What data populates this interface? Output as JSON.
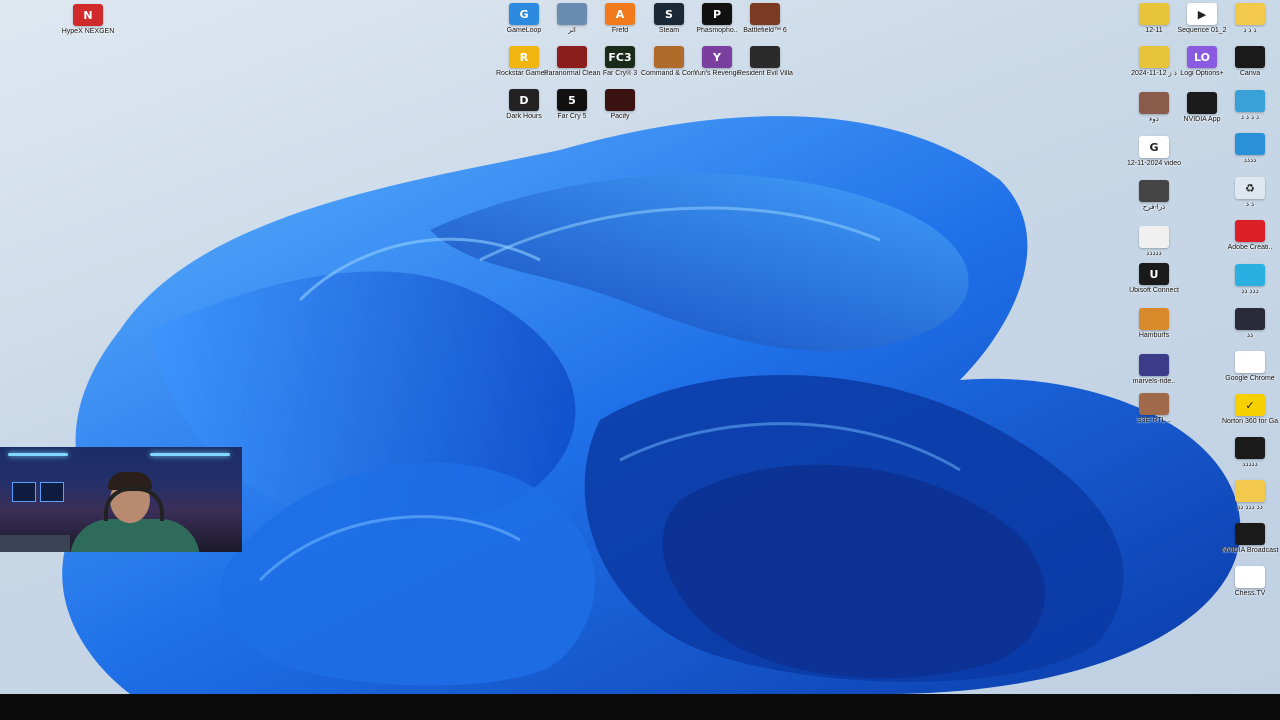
{
  "desktop": {
    "top_left": [
      {
        "label": "HypeX NEXGEN",
        "icon": "hypex-icon",
        "color": "#d12a2a",
        "glyph": "N"
      }
    ],
    "center_icons": [
      {
        "label": "GameLoop",
        "icon": "gameloop-icon",
        "color": "#2c8ae0",
        "glyph": "G"
      },
      {
        "label": "اثر",
        "icon": "game-thumbnail-icon",
        "color": "#6a8cb0",
        "glyph": ""
      },
      {
        "label": "Frefd",
        "icon": "orange-a-icon",
        "color": "#f07a1c",
        "glyph": "A"
      },
      {
        "label": "Steam",
        "icon": "steam-icon",
        "color": "#1b2838",
        "glyph": "S"
      },
      {
        "label": "Phasmopho..",
        "icon": "phasmophobia-icon",
        "color": "#111111",
        "glyph": "P"
      },
      {
        "label": "Battlefield™ 6",
        "icon": "battlefield-icon",
        "color": "#7a3b22",
        "glyph": ""
      },
      {
        "label": "Rockstar Games ..",
        "icon": "rockstar-icon",
        "color": "#f1b50f",
        "glyph": "R"
      },
      {
        "label": "Paranormal Cleanup",
        "icon": "paranormal-cleanup-icon",
        "color": "#8c1d1d",
        "glyph": ""
      },
      {
        "label": "Far Cry® 3",
        "icon": "farcry3-icon",
        "color": "#1a2b1a",
        "glyph": "FC3"
      },
      {
        "label": "Command & Conquer Re..",
        "icon": "command-conquer-icon",
        "color": "#b06a2a",
        "glyph": ""
      },
      {
        "label": "Yuri's Revenge",
        "icon": "yuris-revenge-icon",
        "color": "#7b3fa0",
        "glyph": "Y"
      },
      {
        "label": "Resident Evil Village",
        "icon": "resident-evil-icon",
        "color": "#2b2b2b",
        "glyph": ""
      },
      {
        "label": "Dark Hours",
        "icon": "dark-hours-icon",
        "color": "#222222",
        "glyph": "D"
      },
      {
        "label": "Far Cry 5",
        "icon": "farcry5-icon",
        "color": "#111111",
        "glyph": "5"
      },
      {
        "label": "Pacify",
        "icon": "pacify-icon",
        "color": "#3a1212",
        "glyph": ""
      }
    ],
    "right_col_a": [
      {
        "label": "12-11",
        "icon": "folder-stripe-icon",
        "color": "#e8c43a",
        "glyph": ""
      },
      {
        "label": "ذ ز 12-11-2024",
        "icon": "folder-stripe-icon",
        "color": "#e8c43a",
        "glyph": ""
      },
      {
        "label": "ذوء",
        "icon": "image-thumbnail-icon",
        "color": "#8a5a4a",
        "glyph": ""
      },
      {
        "label": "12-11-2024 video",
        "icon": "chrome-doc-icon",
        "color": "#ffffff",
        "glyph": "G"
      },
      {
        "label": "ذرا-فرح",
        "icon": "video-file-icon",
        "color": "#444444",
        "glyph": ""
      },
      {
        "label": "ذذذذذ",
        "icon": "blank-doc-icon",
        "color": "#f0f0f0",
        "glyph": ""
      },
      {
        "label": "Ubisoft Connect",
        "icon": "ubisoft-icon",
        "color": "#1a1a1a",
        "glyph": "U"
      },
      {
        "label": "Hamburfs",
        "icon": "hamburger-icon",
        "color": "#d88a2a",
        "glyph": ""
      },
      {
        "label": "marvels-ride..",
        "icon": "marvel-thumbnail-icon",
        "color": "#3b3b8a",
        "glyph": ""
      },
      {
        "label": "S3E-RTL ..",
        "icon": "portrait-thumbnail-icon",
        "color": "#a06a4a",
        "glyph": ""
      }
    ],
    "right_col_b": [
      {
        "label": "Sequence 01_2",
        "icon": "video-play-icon",
        "color": "#ffffff",
        "glyph": "▶"
      },
      {
        "label": "Logi Options+",
        "icon": "logi-options-icon",
        "color": "#8a5ae0",
        "glyph": "LO"
      },
      {
        "label": "NVIDIA App",
        "icon": "nvidia-icon",
        "color": "#1a1a1a",
        "glyph": ""
      }
    ],
    "right_col_c": [
      {
        "label": "ذ ذ ذ",
        "icon": "folder-icon",
        "color": "#f2c94c",
        "glyph": ""
      },
      {
        "label": "Canva",
        "icon": "capcut-icon",
        "color": "#1a1a1a",
        "glyph": ""
      },
      {
        "label": "ذ ذ ذ ذ",
        "icon": "monitor-icon",
        "color": "#3aa0d8",
        "glyph": ""
      },
      {
        "label": "ذذذذ",
        "icon": "monitor-blue-icon",
        "color": "#2a90d8",
        "glyph": ""
      },
      {
        "label": "ذ ذ",
        "icon": "recycle-bin-icon",
        "color": "#dfe8f1",
        "glyph": "♻"
      },
      {
        "label": "Adobe Creati..",
        "icon": "creative-cloud-icon",
        "color": "#da1f26",
        "glyph": ""
      },
      {
        "label": "ذذذ ذذ",
        "icon": "image-app-icon",
        "color": "#2ab0e0",
        "glyph": ""
      },
      {
        "label": "ذذ",
        "icon": "thumbnail-dark-icon",
        "color": "#2a2a3a",
        "glyph": ""
      },
      {
        "label": "Google Chrome",
        "icon": "chrome-icon",
        "color": "#ffffff",
        "glyph": ""
      },
      {
        "label": "Norton 360 for Gamers",
        "icon": "norton-icon",
        "color": "#f7d000",
        "glyph": "✓"
      },
      {
        "label": "ذذذذذ",
        "icon": "capcut-dark-icon",
        "color": "#1a1a1a",
        "glyph": ""
      },
      {
        "label": "ذذ ذذذ ذذ",
        "icon": "folder-icon",
        "color": "#f2c94c",
        "glyph": ""
      },
      {
        "label": "NVIDIA Broadcast",
        "icon": "nvidia-broadcast-icon",
        "color": "#1a1a1a",
        "glyph": ""
      },
      {
        "label": "Chess.TV",
        "icon": "chess-tv-icon",
        "color": "#ffffff",
        "glyph": ""
      }
    ]
  },
  "colors": {
    "wallpaper_bg": "#cad9e8",
    "bloom_dark": "#0a3fb8",
    "bloom_light": "#3a9cff",
    "taskbar": "#0b0b0b"
  }
}
